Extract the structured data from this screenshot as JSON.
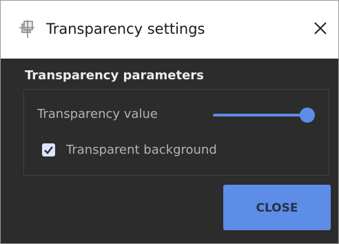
{
  "window": {
    "title": "Transparency settings",
    "app_icon": "transparency-app-icon",
    "close_icon": "close-icon"
  },
  "parameters": {
    "section_title": "Transparency parameters",
    "slider": {
      "label": "Transparency value",
      "value_fraction": 1.0,
      "accent_color": "#5d8de6"
    },
    "checkbox": {
      "label": "Transparent background",
      "checked": true
    }
  },
  "actions": {
    "close_label": "CLOSE"
  },
  "colors": {
    "accent": "#5d8de6",
    "panel_bg": "#2c2c2c",
    "titlebar_bg": "#ffffff"
  }
}
